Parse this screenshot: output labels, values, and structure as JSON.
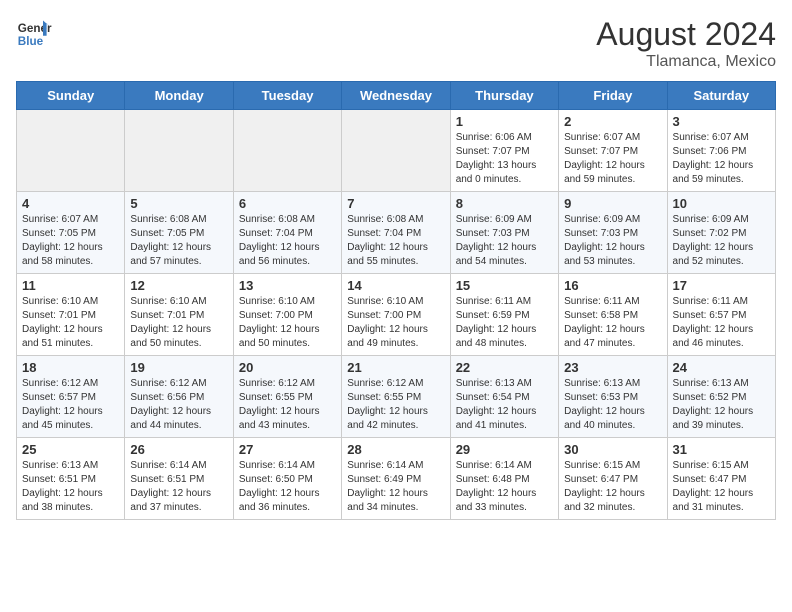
{
  "header": {
    "logo_line1": "General",
    "logo_line2": "Blue",
    "month_year": "August 2024",
    "location": "Tlamanca, Mexico"
  },
  "weekdays": [
    "Sunday",
    "Monday",
    "Tuesday",
    "Wednesday",
    "Thursday",
    "Friday",
    "Saturday"
  ],
  "weeks": [
    [
      {
        "num": "",
        "info": ""
      },
      {
        "num": "",
        "info": ""
      },
      {
        "num": "",
        "info": ""
      },
      {
        "num": "",
        "info": ""
      },
      {
        "num": "1",
        "info": "Sunrise: 6:06 AM\nSunset: 7:07 PM\nDaylight: 13 hours\nand 0 minutes."
      },
      {
        "num": "2",
        "info": "Sunrise: 6:07 AM\nSunset: 7:07 PM\nDaylight: 12 hours\nand 59 minutes."
      },
      {
        "num": "3",
        "info": "Sunrise: 6:07 AM\nSunset: 7:06 PM\nDaylight: 12 hours\nand 59 minutes."
      }
    ],
    [
      {
        "num": "4",
        "info": "Sunrise: 6:07 AM\nSunset: 7:05 PM\nDaylight: 12 hours\nand 58 minutes."
      },
      {
        "num": "5",
        "info": "Sunrise: 6:08 AM\nSunset: 7:05 PM\nDaylight: 12 hours\nand 57 minutes."
      },
      {
        "num": "6",
        "info": "Sunrise: 6:08 AM\nSunset: 7:04 PM\nDaylight: 12 hours\nand 56 minutes."
      },
      {
        "num": "7",
        "info": "Sunrise: 6:08 AM\nSunset: 7:04 PM\nDaylight: 12 hours\nand 55 minutes."
      },
      {
        "num": "8",
        "info": "Sunrise: 6:09 AM\nSunset: 7:03 PM\nDaylight: 12 hours\nand 54 minutes."
      },
      {
        "num": "9",
        "info": "Sunrise: 6:09 AM\nSunset: 7:03 PM\nDaylight: 12 hours\nand 53 minutes."
      },
      {
        "num": "10",
        "info": "Sunrise: 6:09 AM\nSunset: 7:02 PM\nDaylight: 12 hours\nand 52 minutes."
      }
    ],
    [
      {
        "num": "11",
        "info": "Sunrise: 6:10 AM\nSunset: 7:01 PM\nDaylight: 12 hours\nand 51 minutes."
      },
      {
        "num": "12",
        "info": "Sunrise: 6:10 AM\nSunset: 7:01 PM\nDaylight: 12 hours\nand 50 minutes."
      },
      {
        "num": "13",
        "info": "Sunrise: 6:10 AM\nSunset: 7:00 PM\nDaylight: 12 hours\nand 50 minutes."
      },
      {
        "num": "14",
        "info": "Sunrise: 6:10 AM\nSunset: 7:00 PM\nDaylight: 12 hours\nand 49 minutes."
      },
      {
        "num": "15",
        "info": "Sunrise: 6:11 AM\nSunset: 6:59 PM\nDaylight: 12 hours\nand 48 minutes."
      },
      {
        "num": "16",
        "info": "Sunrise: 6:11 AM\nSunset: 6:58 PM\nDaylight: 12 hours\nand 47 minutes."
      },
      {
        "num": "17",
        "info": "Sunrise: 6:11 AM\nSunset: 6:57 PM\nDaylight: 12 hours\nand 46 minutes."
      }
    ],
    [
      {
        "num": "18",
        "info": "Sunrise: 6:12 AM\nSunset: 6:57 PM\nDaylight: 12 hours\nand 45 minutes."
      },
      {
        "num": "19",
        "info": "Sunrise: 6:12 AM\nSunset: 6:56 PM\nDaylight: 12 hours\nand 44 minutes."
      },
      {
        "num": "20",
        "info": "Sunrise: 6:12 AM\nSunset: 6:55 PM\nDaylight: 12 hours\nand 43 minutes."
      },
      {
        "num": "21",
        "info": "Sunrise: 6:12 AM\nSunset: 6:55 PM\nDaylight: 12 hours\nand 42 minutes."
      },
      {
        "num": "22",
        "info": "Sunrise: 6:13 AM\nSunset: 6:54 PM\nDaylight: 12 hours\nand 41 minutes."
      },
      {
        "num": "23",
        "info": "Sunrise: 6:13 AM\nSunset: 6:53 PM\nDaylight: 12 hours\nand 40 minutes."
      },
      {
        "num": "24",
        "info": "Sunrise: 6:13 AM\nSunset: 6:52 PM\nDaylight: 12 hours\nand 39 minutes."
      }
    ],
    [
      {
        "num": "25",
        "info": "Sunrise: 6:13 AM\nSunset: 6:51 PM\nDaylight: 12 hours\nand 38 minutes."
      },
      {
        "num": "26",
        "info": "Sunrise: 6:14 AM\nSunset: 6:51 PM\nDaylight: 12 hours\nand 37 minutes."
      },
      {
        "num": "27",
        "info": "Sunrise: 6:14 AM\nSunset: 6:50 PM\nDaylight: 12 hours\nand 36 minutes."
      },
      {
        "num": "28",
        "info": "Sunrise: 6:14 AM\nSunset: 6:49 PM\nDaylight: 12 hours\nand 34 minutes."
      },
      {
        "num": "29",
        "info": "Sunrise: 6:14 AM\nSunset: 6:48 PM\nDaylight: 12 hours\nand 33 minutes."
      },
      {
        "num": "30",
        "info": "Sunrise: 6:15 AM\nSunset: 6:47 PM\nDaylight: 12 hours\nand 32 minutes."
      },
      {
        "num": "31",
        "info": "Sunrise: 6:15 AM\nSunset: 6:47 PM\nDaylight: 12 hours\nand 31 minutes."
      }
    ]
  ]
}
